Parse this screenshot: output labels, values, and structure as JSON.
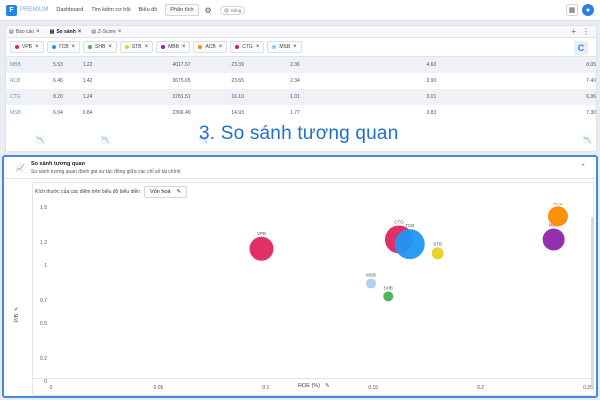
{
  "app": {
    "brand": "PREMIUM",
    "logo": "F"
  },
  "nav": {
    "dashboard": "Dashboard",
    "search": "Tìm kiếm cơ hội",
    "charts": "Biểu đồ",
    "analysis": "Phân tích",
    "toggle": "Sáng"
  },
  "tabs": [
    {
      "label": "Báo cáo"
    },
    {
      "label": "So sánh",
      "active": true
    },
    {
      "label": "Z-Score"
    }
  ],
  "chips": [
    {
      "label": "VPB",
      "color": "#e0245e"
    },
    {
      "label": "TCB",
      "color": "#2196f3"
    },
    {
      "label": "SHB",
      "color": "#4caf50"
    },
    {
      "label": "STB",
      "color": "#f4c430"
    },
    {
      "label": "MBB",
      "color": "#8e24aa"
    },
    {
      "label": "ACB",
      "color": "#fb8c00"
    },
    {
      "label": "CTG",
      "color": "#d81b60"
    },
    {
      "label": "MSB",
      "color": "#90caf9"
    }
  ],
  "table": [
    {
      "name": "MBB",
      "c1": "5.53",
      "c2": "1.22",
      "c3": "4017.67",
      "c4": "23.39",
      "c5": "2.36",
      "c6": "4.60",
      "c7": "8.05"
    },
    {
      "name": "ACB",
      "c1": "6.46",
      "c2": "1.42",
      "c3": "3675.65",
      "c4": "23.65",
      "c5": "2.34",
      "c6": "3.90",
      "c7": "7.40"
    },
    {
      "name": "CTG",
      "c1": "8.20",
      "c2": "1.24",
      "c3": "3781.51",
      "c4": "16.10",
      "c5": "1.01",
      "c6": "3.01",
      "c7": "6.96"
    },
    {
      "name": "MSB",
      "c1": "6.04",
      "c2": "0.84",
      "c3": "2366.46",
      "c4": "14.93",
      "c5": "1.77",
      "c6": "3.83",
      "c7": "7.30"
    }
  ],
  "overlay": "3. So sánh tương quan",
  "chart_panel": {
    "title": "So sánh tương quan",
    "subtitle": "So sánh tương quan đánh giá sự tác động giữa các chỉ số tài chính",
    "size_label": "Kích thước của các điểm trên biểu đồ biểu diễn",
    "size_value": "Vốn hoá"
  },
  "chart_data": {
    "type": "scatter",
    "xlabel": "ROE (%)",
    "ylabel": "P/B",
    "xlim": [
      0,
      0.25
    ],
    "ylim": [
      0,
      1.5
    ],
    "xticks": [
      "0",
      "0.05",
      "0.1",
      "0.15",
      "0.2",
      "0.25"
    ],
    "yticks": [
      "0",
      "0.2",
      "0.5",
      "0.7",
      "1",
      "1.2",
      "1.5"
    ],
    "points": [
      {
        "label": "VPB",
        "x": 0.098,
        "y": 1.14,
        "size": 12,
        "color": "#e0245e"
      },
      {
        "label": "CTG",
        "x": 0.162,
        "y": 1.22,
        "size": 14,
        "color": "#e0245e"
      },
      {
        "label": "TCB",
        "x": 0.167,
        "y": 1.18,
        "size": 15,
        "color": "#2196f3"
      },
      {
        "label": "STB",
        "x": 0.18,
        "y": 1.1,
        "size": 6,
        "color": "#e6d11e"
      },
      {
        "label": "MSB",
        "x": 0.149,
        "y": 0.84,
        "size": 5,
        "color": "#a9cdf5"
      },
      {
        "label": "SHB",
        "x": 0.157,
        "y": 0.73,
        "size": 5,
        "color": "#4caf50"
      },
      {
        "label": "MBB",
        "x": 0.234,
        "y": 1.22,
        "size": 11,
        "color": "#8e24aa"
      },
      {
        "label": "ACB",
        "x": 0.236,
        "y": 1.42,
        "size": 10,
        "color": "#fb8c00"
      }
    ]
  }
}
